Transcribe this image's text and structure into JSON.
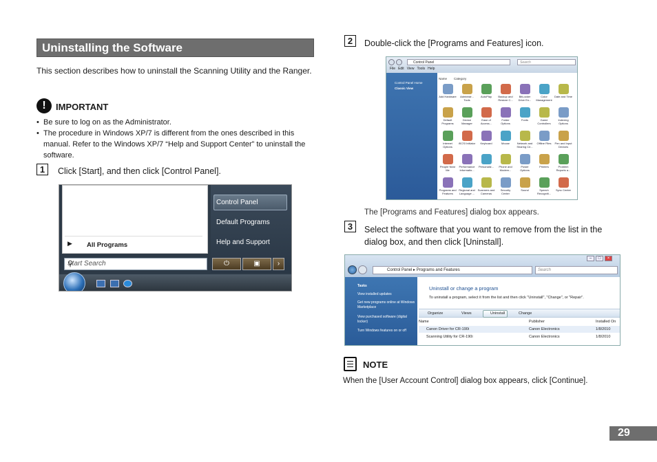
{
  "section_title": "Uninstalling the Software",
  "intro": "This section describes how to uninstall the Scanning Utility and the Ranger.",
  "important": {
    "icon": "exclamation-icon",
    "title": "IMPORTANT",
    "bullets": [
      "Be sure to log on as the Administrator.",
      "The procedure in Windows XP/7 is different from the ones described in this manual. Refer to the Windows XP/7 “Help and Support Center” to uninstall the software."
    ]
  },
  "steps": [
    {
      "num": "1",
      "text": "Click [Start], and then click [Control Panel]."
    },
    {
      "num": "2",
      "text": "Double-click the [Programs and Features] icon."
    },
    {
      "num": "3",
      "text": "Select the software that you want to remove from the list in the dialog box, and then click [Uninstall]."
    }
  ],
  "start_menu": {
    "all_programs": "All Programs",
    "search_placeholder": "Start Search",
    "right_items": [
      "Control Panel",
      "Default Programs",
      "Help and Support"
    ]
  },
  "control_panel": {
    "address": "Control Panel",
    "search": "Search",
    "menu": [
      "File",
      "Edit",
      "View",
      "Tools",
      "Help"
    ],
    "sidebar": [
      "Control Panel Home",
      "Classic View"
    ],
    "columns": [
      "Name",
      "Category"
    ],
    "icons": [
      "Add Hardware",
      "Administr... Tools",
      "AutoPlay",
      "Backup and Restore C...",
      "BitLocker Drive En...",
      "Color Management",
      "Date and Time",
      "Default Programs",
      "Device Manager",
      "Ease of Access...",
      "Folder Options",
      "Fonts",
      "Game Controllers",
      "Indexing Options",
      "Internet Options",
      "iSCSI Initiator",
      "Keyboard",
      "Mouse",
      "Network and Sharing Ce...",
      "Offline Files",
      "Pen and Input Devices",
      "People Near Me",
      "Performance Informatio...",
      "Personaliz...",
      "Phone and Modem...",
      "Power Options",
      "Printers",
      "Problem Reports a...",
      "Programs and Features",
      "Regional and Language ...",
      "Scanners and Cameras",
      "Security Center",
      "Sound",
      "Speech Recogniti...",
      "Sync Center"
    ]
  },
  "caption": "The [Programs and Features] dialog box appears.",
  "programs_features": {
    "address": [
      "Control Panel",
      "Programs and Features"
    ],
    "search": "Search",
    "sidebar": [
      "Tasks",
      "View installed updates",
      "Get new programs online at Windows Marketplace",
      "View purchased software (digital locker)",
      "Turn Windows features on or off"
    ],
    "heading": "Uninstall or change a program",
    "subheading": "To uninstall a program, select it from the list and then click \"Uninstall\", \"Change\", or \"Repair\".",
    "toolbar": [
      "Organize",
      "Views",
      "Uninstall",
      "Change"
    ],
    "columns": [
      "Name",
      "Publisher",
      "Installed On"
    ],
    "rows": [
      {
        "name": "Canon Driver for CR-190i",
        "publisher": "Canon Electronics",
        "date": "1/8/2010"
      },
      {
        "name": "Scanning Utility for CR-190i",
        "publisher": "Canon Electronics",
        "date": "1/8/2010"
      }
    ]
  },
  "note": {
    "icon": "note-icon",
    "title": "NOTE",
    "text": "When the [User Account Control] dialog box appears, click [Continue]."
  },
  "page_number": "29"
}
